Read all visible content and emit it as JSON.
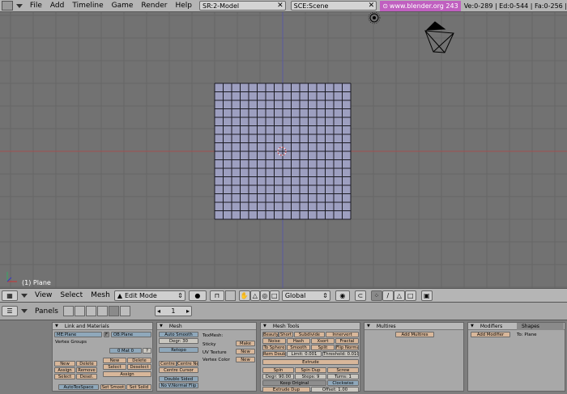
{
  "topbar": {
    "menus": [
      "File",
      "Add",
      "Timeline",
      "Game",
      "Render",
      "Help"
    ],
    "screen": "SR:2-Model",
    "scene": "SCE:Scene",
    "url": "www.blender.org 243",
    "stats": "Ve:0-289 | Ed:0-544 | Fa:0-256 |"
  },
  "viewport": {
    "object_label": "(1) Plane"
  },
  "view3d_header": {
    "menus": [
      "View",
      "Select",
      "Mesh"
    ],
    "mode": "Edit Mode",
    "orientation": "Global"
  },
  "buttons_header": {
    "panels_label": "Panels",
    "frame": "1"
  },
  "link_materials": {
    "title": "Link and Materials",
    "me_name": "ME:Plane",
    "f_label": "F",
    "ob_name": "OB:Plane",
    "vertex_groups_label": "Vertex Groups",
    "mat_field": "0 Mat 0",
    "q_btn": "?",
    "buttons": [
      "New",
      "Delete",
      "Assign",
      "Remove",
      "Select",
      "Desel.",
      "New",
      "Delete",
      "Select",
      "Deselect",
      "Assign"
    ],
    "autotexspace": "AutoTexSpace",
    "set_smooth": "Set Smoot",
    "set_solid": "Set Solid"
  },
  "mesh": {
    "title": "Mesh",
    "auto_smooth": "Auto Smooth",
    "degr": "Degr: 30",
    "retopo": "Retopo",
    "centre": "Centre",
    "centre_new": "Centre New",
    "centre_cursor": "Centre Cursor",
    "double_sided": "Double Sided",
    "no_vnormal_flip": "No V.Normal Flip",
    "texmesh_label": "TexMesh:",
    "sticky_label": "Sticky",
    "uv_texture_label": "UV Texture",
    "vertex_color_label": "Vertex Color",
    "make": "Make",
    "new1": "New",
    "new2": "New"
  },
  "mesh_tools": {
    "title": "Mesh Tools",
    "row1": [
      "Beauty",
      "Short",
      "Subdivide",
      "Innervert"
    ],
    "row2": [
      "Noise",
      "Hash",
      "Xsort",
      "Fractal"
    ],
    "row3": [
      "To Sphere",
      "Smooth",
      "Split",
      "Flip Normal"
    ],
    "rem_doubles": "Rem Doubl",
    "limit": "Limit: 0.001",
    "threshold": "Threshold: 0.010",
    "extrude": "Extrude",
    "spin": "Spin",
    "spin_dup": "Spin Dup",
    "screw": "Screw",
    "degr": "Degr: 90.00",
    "steps": "Steps: 9",
    "turns": "Turns: 1",
    "keep_original": "Keep Original",
    "clockwise": "Clockwise",
    "extrude_dup": "Extrude Dup",
    "offset": "Offset: 1.00"
  },
  "multires": {
    "title": "Multires",
    "add_multires": "Add Multires"
  },
  "modifiers": {
    "tab_modifiers": "Modifiers",
    "tab_shapes": "Shapes",
    "add_modifier": "Add Modifier",
    "to_label": "To: Plane"
  },
  "colors": {
    "viewport_bg": "#727272",
    "mesh_face": "#9d9fc0",
    "mesh_edge": "#000000",
    "x_axis": "#a05050",
    "y_axis": "#5a5aa0",
    "url_bg": "#c060c0"
  }
}
